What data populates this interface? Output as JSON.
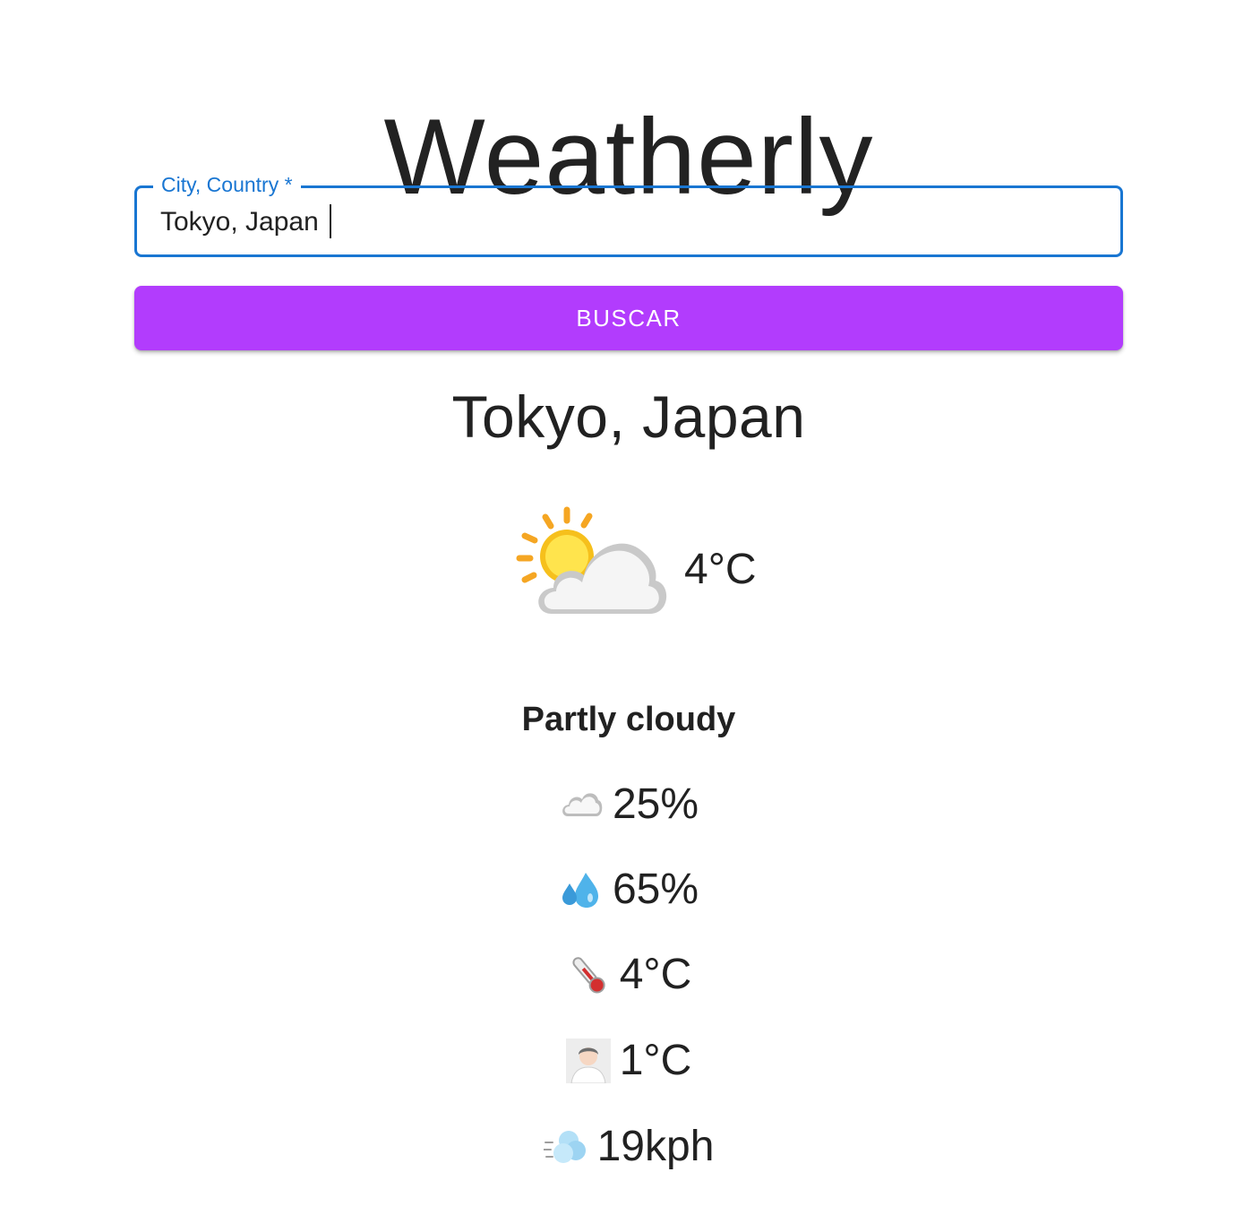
{
  "app": {
    "title": "Weatherly"
  },
  "search": {
    "label": "City, Country *",
    "value": "Tokyo, Japan",
    "button_label": "BUSCAR"
  },
  "result": {
    "location": "Tokyo, Japan",
    "current_temp": "4°C",
    "condition": "Partly cloudy",
    "icon": "partly-cloudy-icon",
    "stats": [
      {
        "icon": "cloud-icon",
        "value": "25%"
      },
      {
        "icon": "sweat-droplets-icon",
        "value": "65%"
      },
      {
        "icon": "thermometer-icon",
        "value": "4°C"
      },
      {
        "icon": "person-icon",
        "value": "1°C"
      },
      {
        "icon": "wind-icon",
        "value": "19kph"
      }
    ]
  },
  "colors": {
    "input_border": "#1976d2",
    "button": "#b23cfd",
    "text": "#212121"
  }
}
